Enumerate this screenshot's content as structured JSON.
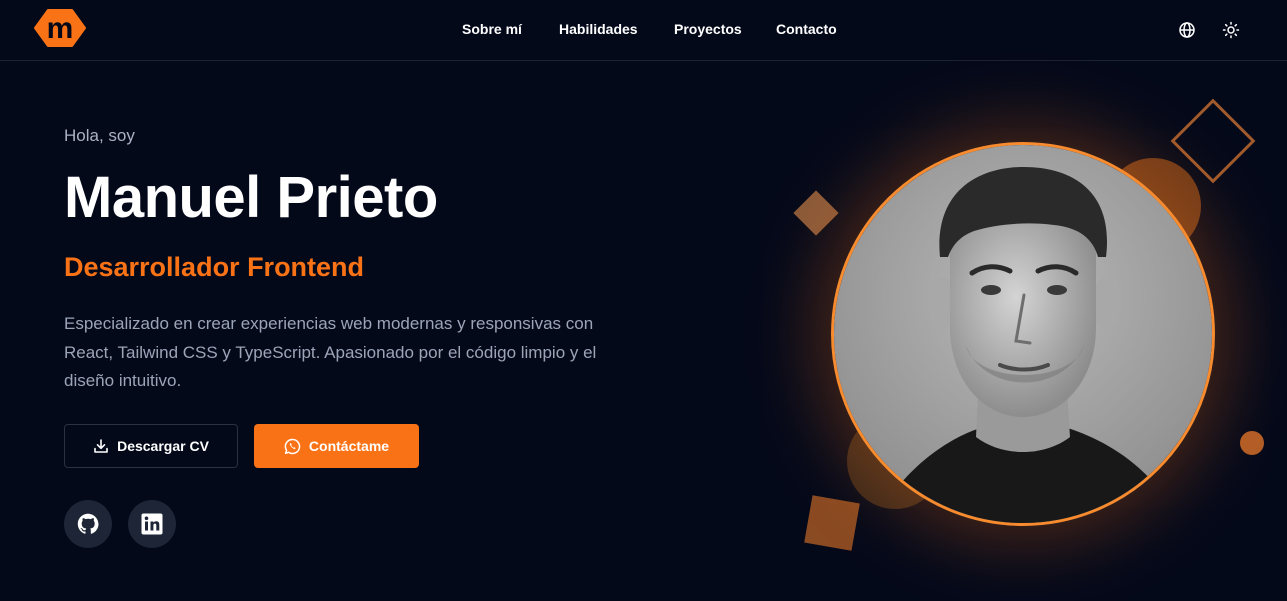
{
  "nav": {
    "logo_letter": "m",
    "links": [
      "Sobre mí",
      "Habilidades",
      "Proyectos",
      "Contacto"
    ],
    "icons": [
      "globe-icon",
      "sun-icon"
    ]
  },
  "hero": {
    "greeting": "Hola, soy",
    "name": "Manuel Prieto",
    "role": "Desarrollador Frontend",
    "description": "Especializado en crear experiencias web modernas y responsivas con React, Tailwind CSS y TypeScript. Apasionado por el código limpio y el diseño intuitivo.",
    "buttons": {
      "download_cv": "Descargar CV",
      "contact": "Contáctame"
    },
    "social": [
      "github-icon",
      "linkedin-icon"
    ]
  },
  "colors": {
    "background": "#04091a",
    "accent": "#f97316",
    "muted_text": "#9ca5b8",
    "social_bg": "#1e2536"
  }
}
